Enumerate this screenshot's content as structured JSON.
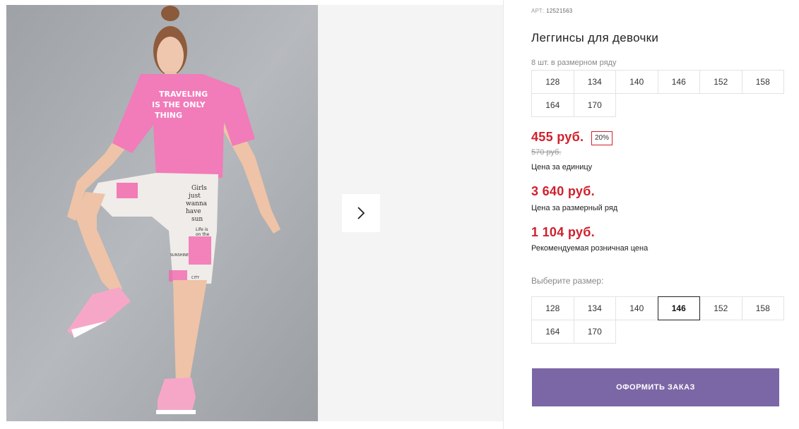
{
  "product": {
    "art_label": "АРТ:",
    "art_number": "12521563",
    "title": "Леггинсы для девочки",
    "pack_note": "8 шт. в размерном ряду"
  },
  "pack_sizes": [
    "128",
    "134",
    "140",
    "146",
    "152",
    "158",
    "164",
    "170"
  ],
  "prices": {
    "unit_price": "455 руб.",
    "discount": "20%",
    "old_price": "570 руб.",
    "unit_label": "Цена за единицу",
    "pack_price": "3 640 руб.",
    "pack_label": "Цена за размерный ряд",
    "retail_price": "1 104 руб.",
    "retail_label": "Рекомендуемая розничная цена"
  },
  "size_select": {
    "label": "Выберите размер:",
    "options": [
      "128",
      "134",
      "140",
      "146",
      "152",
      "158",
      "164",
      "170"
    ],
    "selected": "146"
  },
  "order_button": "ОФОРМИТЬ ЗАКАЗ",
  "photo_shirt_text": [
    "TRAVELING",
    "IS THE ONLY",
    "THING"
  ],
  "photo_print_text": [
    "Girls",
    "just",
    "wanna",
    "have",
    "sun",
    "Life is",
    "on the",
    "SUNSHINE",
    "CITY"
  ],
  "colors": {
    "accent_red": "#d0202c",
    "order_button": "#7b66a6",
    "selected_border": "#222222"
  },
  "icons": {
    "next": "chevron-right-icon"
  }
}
